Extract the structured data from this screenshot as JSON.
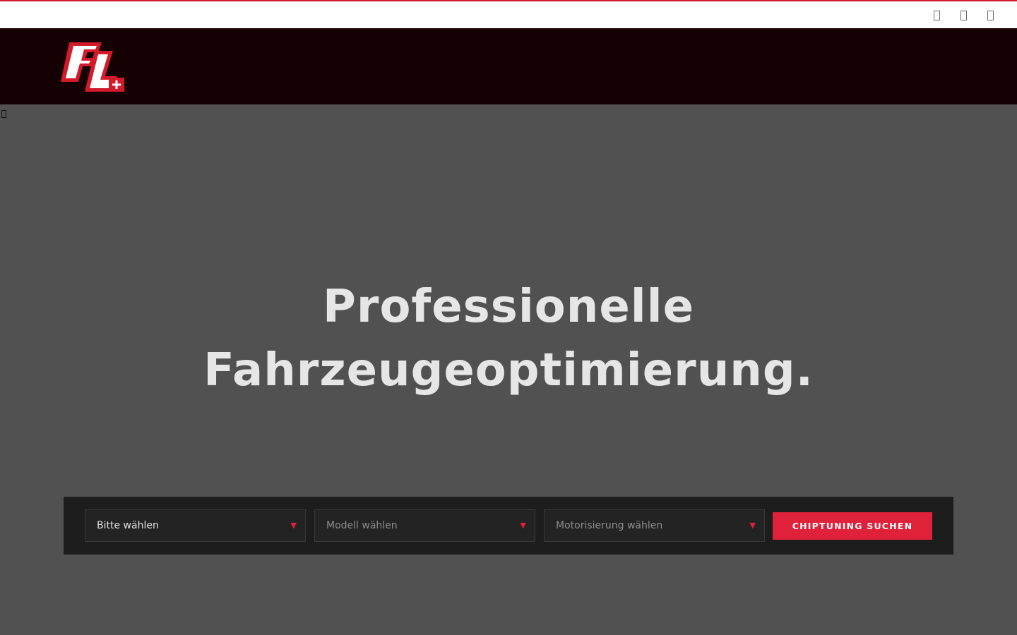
{
  "topbar": {
    "icons": [
      {
        "name": "phone-icon"
      },
      {
        "name": "mail-icon"
      },
      {
        "name": "location-icon"
      }
    ],
    "accent_color": "#d11a2a"
  },
  "header": {
    "logo_name": "fl-logo",
    "background": "#150003"
  },
  "hero": {
    "headline_line1": "Professionelle",
    "headline_line2": "Fahrzeugeoptimierung."
  },
  "search": {
    "brand_select": "Bitte wählen",
    "model_select": "Modell wählen",
    "engine_select": "Motorisierung wählen",
    "button_label": "CHIPTUNING SUCHEN",
    "arrow_glyph": "▼",
    "accent_color": "#e0213a"
  }
}
